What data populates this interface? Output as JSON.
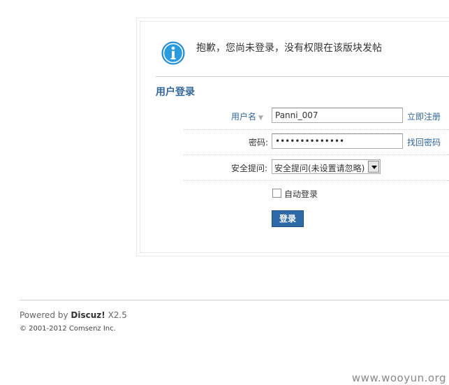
{
  "notice": {
    "icon": "info-icon",
    "text": "抱歉，您尚未登录，没有权限在该版块发帖"
  },
  "login": {
    "title": "用户登录",
    "username_label": "用户名",
    "username_value": "Panni_007",
    "register_link": "立即注册",
    "password_label": "密码:",
    "password_value": "aaaaaaaaaaaaaa",
    "forgot_link": "找回密码",
    "security_label": "安全提问:",
    "security_value": "安全提问(未设置请忽略)",
    "auto_login_label": "自动登录",
    "submit_label": "登录"
  },
  "footer": {
    "powered_prefix": "Powered by",
    "powered_brand": "Discuz!",
    "powered_version": "X2.5",
    "copyright": "© 2001-2012 Comsenz Inc."
  },
  "watermark": "www.wooyun.org",
  "colors": {
    "accent": "#336699",
    "button": "#2f6aa8",
    "info_icon": "#2b9be0"
  }
}
